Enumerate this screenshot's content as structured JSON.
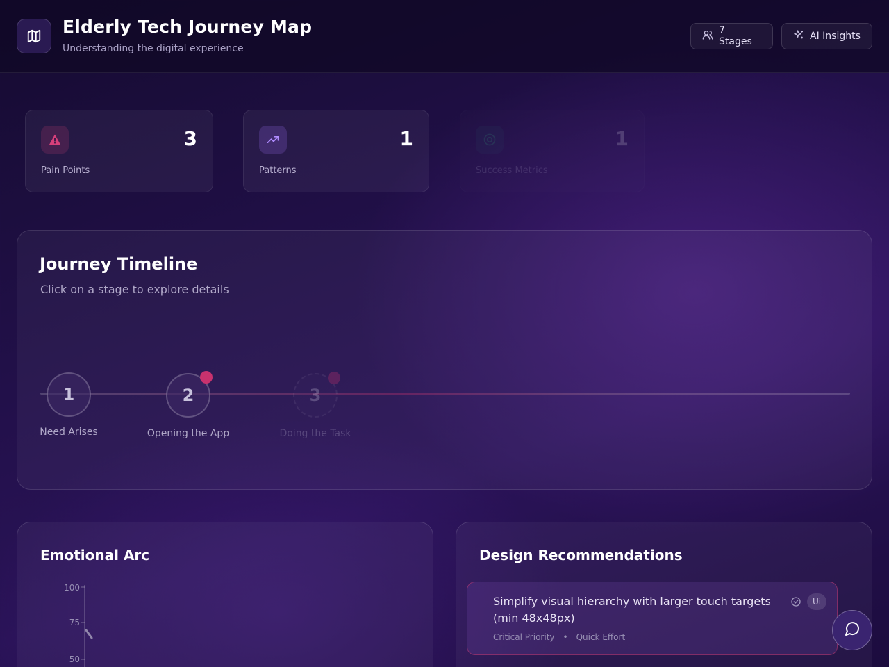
{
  "header": {
    "title": "Elderly Tech Journey Map",
    "subtitle": "Understanding the digital experience",
    "stages_button": "7 Stages",
    "insights_button": "AI Insights"
  },
  "stats": [
    {
      "value": "3",
      "label": "Pain Points",
      "icon": "alert-triangle-icon",
      "color": "#d6407a"
    },
    {
      "value": "1",
      "label": "Patterns",
      "icon": "trending-up-icon",
      "color": "#9a6cf0"
    },
    {
      "value": "1",
      "label": "Success Metrics",
      "icon": "target-icon",
      "color": "#3cc88c"
    }
  ],
  "timeline": {
    "title": "Journey Timeline",
    "subtitle": "Click on a stage to explore details",
    "stages": [
      {
        "number": "1",
        "label": "Need Arises"
      },
      {
        "number": "2",
        "label": "Opening the App"
      },
      {
        "number": "3",
        "label": "Doing the Task"
      }
    ]
  },
  "emotional_arc": {
    "title": "Emotional Arc",
    "y_ticks": [
      "100",
      "75",
      "50"
    ]
  },
  "recommendations": {
    "title": "Design Recommendations",
    "items": [
      {
        "text": "Simplify visual hierarchy with larger touch targets (min 48x48px)",
        "priority": "Critical Priority",
        "effort": "Quick Effort",
        "tag": "Ui"
      }
    ]
  },
  "colors": {
    "accent_pink": "#c8326e",
    "accent_purple": "#7c4ddc",
    "background": "#22104a"
  }
}
